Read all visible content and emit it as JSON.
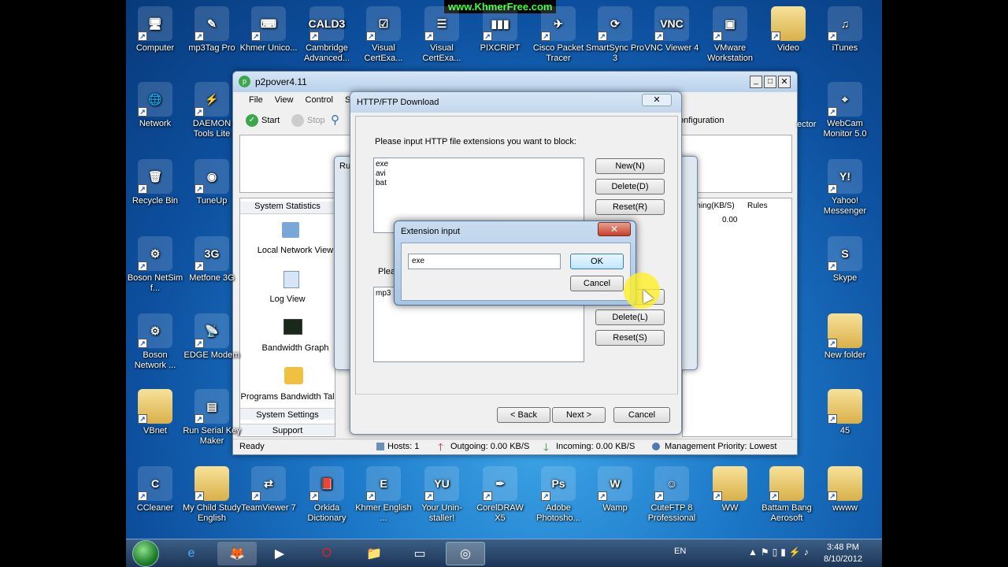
{
  "watermark": "www.KhmerFree.com",
  "desktop_left": [
    {
      "label": "Computer",
      "g": "🖥"
    },
    {
      "label": "Network",
      "g": "🌐"
    },
    {
      "label": "Recycle Bin",
      "g": "🗑"
    },
    {
      "label": "Boson NetSim f...",
      "g": "⚙"
    },
    {
      "label": "Boson Network ...",
      "g": "⚙"
    },
    {
      "label": "VBnet",
      "g": ""
    }
  ],
  "desktop_col2": [
    {
      "label": "mp3Tag Pro",
      "g": "✎"
    },
    {
      "label": "DAEMON Tools Lite",
      "g": "⚡"
    },
    {
      "label": "TuneUp",
      "g": "◉"
    },
    {
      "label": "Metfone 3G",
      "g": "3G"
    },
    {
      "label": "EDGE Modem",
      "g": "📡"
    },
    {
      "label": "Run Serial Key Maker",
      "g": "▤"
    }
  ],
  "desktop_top": [
    {
      "label": "Khmer Unico...",
      "g": "⌨"
    },
    {
      "label": "Cambridge Advanced...",
      "g": "CALD3"
    },
    {
      "label": "Visual CertExa...",
      "g": "☑"
    },
    {
      "label": "Visual CertExa...",
      "g": "☰"
    },
    {
      "label": "PIXCRIPT",
      "g": "▮▮▮"
    },
    {
      "label": "Cisco Packet Tracer",
      "g": "✈"
    },
    {
      "label": "SmartSync Pro 3",
      "g": "⟳"
    },
    {
      "label": "VNC Viewer 4",
      "g": "VNC"
    },
    {
      "label": "VMware Workstation",
      "g": "▣"
    },
    {
      "label": "Video",
      "g": ""
    },
    {
      "label": "iTunes",
      "g": "♫"
    }
  ],
  "desktop_right": [
    {
      "label": "WebCam Monitor 5.0",
      "g": "⌖"
    },
    {
      "label": "Yahoo! Messenger",
      "g": "Y!"
    },
    {
      "label": "Skype",
      "g": "S"
    },
    {
      "label": "New folder",
      "g": ""
    },
    {
      "label": "45",
      "g": ""
    }
  ],
  "desktop_bottom": [
    {
      "label": "CCleaner",
      "g": "C"
    },
    {
      "label": "My Child Study English",
      "g": ""
    },
    {
      "label": "TeamViewer 7",
      "g": "⇄"
    },
    {
      "label": "Orkida Dictionary",
      "g": "📕"
    },
    {
      "label": "Khmer English ...",
      "g": "E"
    },
    {
      "label": "Your Unin-staller!",
      "g": "YU"
    },
    {
      "label": "CorelDRAW X5",
      "g": "✒"
    },
    {
      "label": "Adobe Photosho...",
      "g": "Ps"
    },
    {
      "label": "Wamp",
      "g": "W"
    },
    {
      "label": "CuteFTP 8 Professional",
      "g": "☺"
    },
    {
      "label": "WW",
      "g": ""
    },
    {
      "label": "Battam Bang Aerosoft",
      "g": ""
    },
    {
      "label": "wwww",
      "g": ""
    }
  ],
  "main_window": {
    "title": "p2pover4.11",
    "menu": [
      "File",
      "View",
      "Control",
      "Se"
    ],
    "toolbar": {
      "start": "Start",
      "stop": "Stop",
      "s": "S",
      "config": "onfiguration"
    },
    "side": [
      "System Statistics",
      "Local Network View",
      "Log View",
      "Bandwidth Graph",
      "Programs Bandwidth Tal",
      "System Settings",
      "Support"
    ],
    "cols": {
      "incoming": "coming(KB/S)",
      "rules": "Rules"
    },
    "value": "0.00",
    "status": {
      "ready": "Ready",
      "hosts": "Hosts: 1",
      "out": "Outgoing: 0.00 KB/S",
      "in": "Incoming: 0.00 KB/S",
      "mgmt": "Management Priority: Lowest"
    },
    "sector": "ector"
  },
  "run_window_title": "Ru",
  "http_dialog": {
    "title": "HTTP/FTP Download",
    "prompt": "Please input HTTP file extensions you want to block:",
    "extensions": [
      "exe",
      "avi",
      "bat"
    ],
    "second_prompt": "Pleas",
    "second_list": [
      "mp3"
    ],
    "new1": "New(N)",
    "delete1": "Delete(D)",
    "reset1": "Reset(R)",
    "delete2": "Delete(L)",
    "reset2": "Reset(S)",
    "back": "< Back",
    "next": "Next >",
    "cancel": "Cancel"
  },
  "ext_dialog": {
    "title": "Extension input",
    "value": "exe",
    "ok": "OK",
    "cancel": "Cancel"
  },
  "tray": {
    "lang": "EN",
    "time": "3:48 PM",
    "date": "8/10/2012"
  }
}
